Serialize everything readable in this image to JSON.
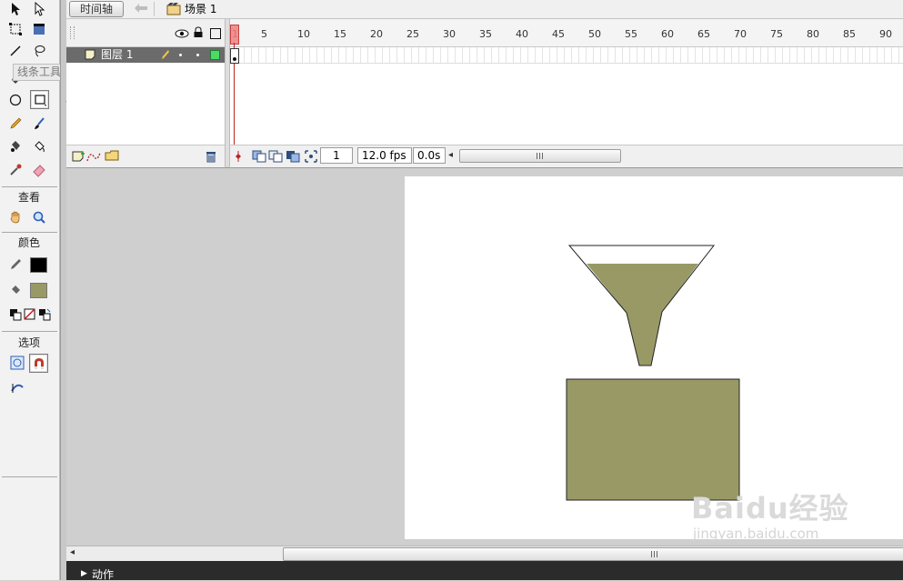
{
  "tools_panel": {
    "tooltip": "线条工具 (N)",
    "sections": {
      "view": "查看",
      "colors": "颜色",
      "options": "选项"
    },
    "colors": {
      "stroke": "#000000",
      "fill": "#999966"
    }
  },
  "top_bar": {
    "timeline_button": "时间轴",
    "scene": "场景 1"
  },
  "timeline": {
    "layer_name": "图层 1",
    "ruler_ticks": [
      "1",
      "5",
      "10",
      "15",
      "20",
      "25",
      "30",
      "35",
      "40",
      "45",
      "50",
      "55",
      "60",
      "65",
      "70",
      "75",
      "80",
      "85",
      "90"
    ],
    "current_frame": "1",
    "frame_rate": "12.0 fps",
    "elapsed_time": "0.0s"
  },
  "stage": {
    "shape_fill": "#999966",
    "stroke_color": "#222222"
  },
  "bottom_panel": {
    "actions_label": "动作"
  },
  "watermark": {
    "brand": "Baidu经验",
    "url": "jingyan.baidu.com"
  }
}
